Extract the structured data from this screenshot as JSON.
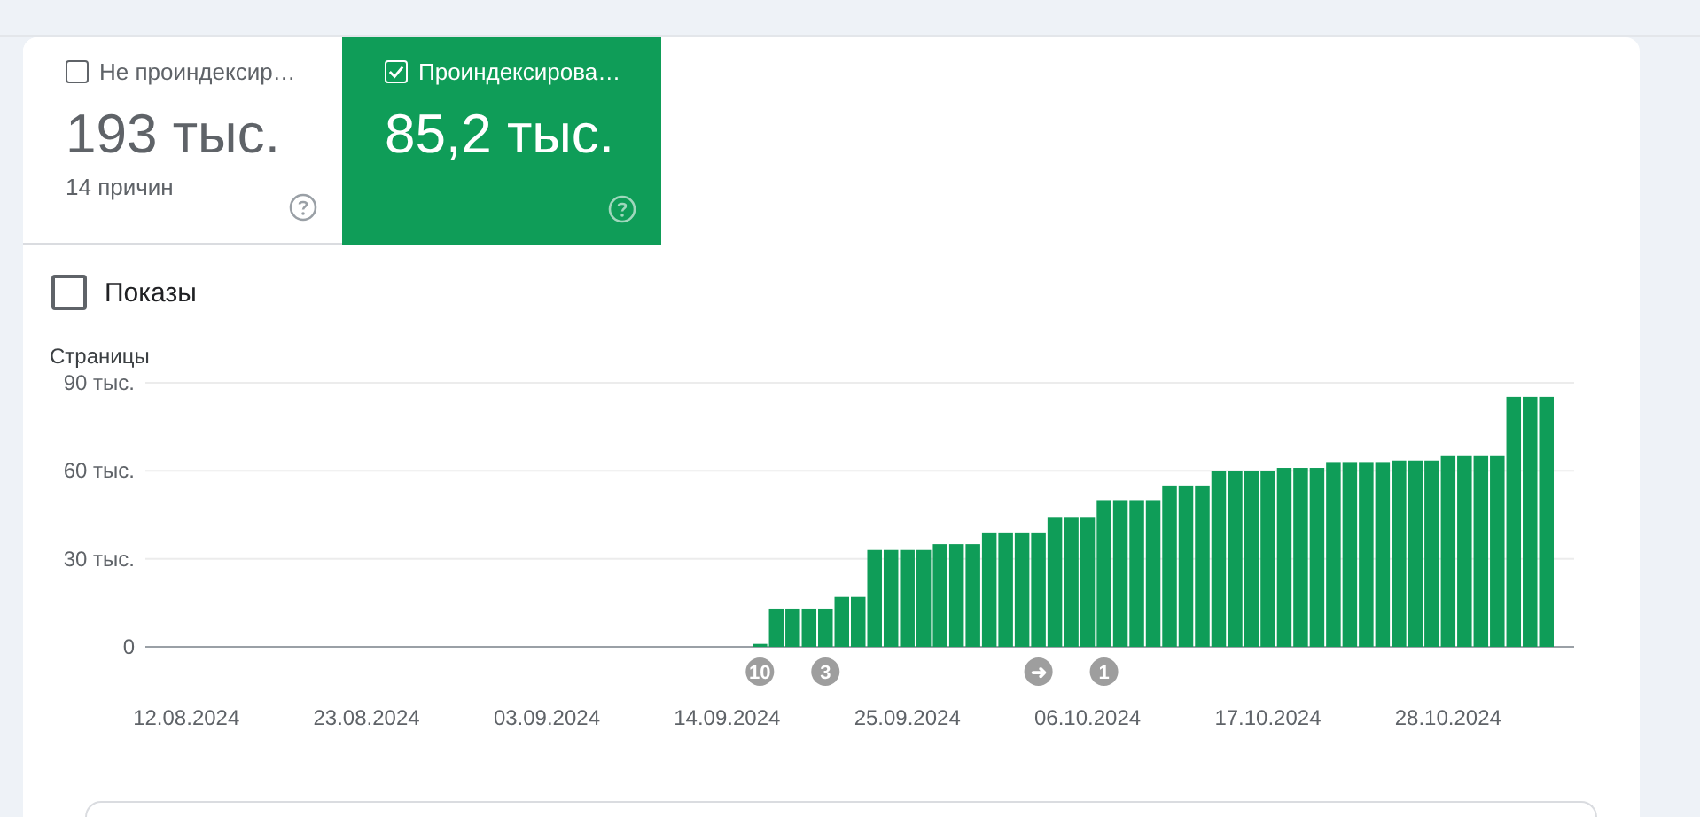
{
  "metric_tabs": [
    {
      "label": "Не проиндексир…",
      "value": "193 тыс.",
      "caption": "14 причин",
      "selected": false,
      "checked": false
    },
    {
      "label": "Проиндексирова…",
      "value": "85,2 тыс.",
      "selected": true,
      "checked": true
    }
  ],
  "impressions_toggle": {
    "label": "Показы",
    "checked": false
  },
  "chart": {
    "chart_data": {
      "type": "bar",
      "ylabel": "Страницы",
      "categories": [
        null,
        null,
        "12.08.2024",
        null,
        null,
        null,
        null,
        null,
        null,
        null,
        null,
        null,
        null,
        "23.08.2024",
        null,
        null,
        null,
        null,
        null,
        null,
        null,
        null,
        null,
        null,
        "03.09.2024",
        null,
        null,
        null,
        null,
        null,
        null,
        null,
        null,
        null,
        null,
        "14.09.2024",
        null,
        null,
        null,
        null,
        null,
        null,
        null,
        null,
        null,
        null,
        "25.09.2024",
        null,
        null,
        null,
        null,
        null,
        null,
        null,
        null,
        null,
        null,
        "06.10.2024",
        null,
        null,
        null,
        null,
        null,
        null,
        null,
        null,
        null,
        null,
        "17.10.2024",
        null,
        null,
        null,
        null,
        null,
        null,
        null,
        null,
        null,
        null,
        "28.10.2024",
        null,
        null,
        null,
        null,
        null,
        null
      ],
      "series": [
        {
          "color": "#0f9d58",
          "values": [
            null,
            null,
            null,
            null,
            null,
            null,
            null,
            null,
            null,
            null,
            null,
            null,
            null,
            null,
            null,
            null,
            null,
            null,
            null,
            null,
            null,
            null,
            null,
            null,
            null,
            null,
            null,
            null,
            null,
            null,
            null,
            null,
            null,
            null,
            null,
            null,
            null,
            1,
            13,
            13,
            13,
            13,
            17,
            17,
            33,
            33,
            33,
            33,
            35,
            35,
            35,
            39,
            39,
            39,
            39,
            44,
            44,
            44,
            50,
            50,
            50,
            50,
            55,
            55,
            55,
            60,
            60,
            60,
            60,
            61,
            61,
            61,
            63,
            63,
            63,
            63,
            63.5,
            63.5,
            63.5,
            65,
            65,
            65,
            65,
            85.2,
            85.2,
            85.2
          ]
        }
      ],
      "ylim": [
        0,
        90
      ],
      "yticks": [
        {
          "value": 0,
          "label": "0"
        },
        {
          "value": 30,
          "label": "30 тыс."
        },
        {
          "value": 60,
          "label": "60 тыс."
        },
        {
          "value": 90,
          "label": "90 тыс."
        }
      ]
    },
    "event_markers": [
      {
        "text": "10"
      },
      {
        "text": "3"
      },
      {
        "text": "➜"
      },
      {
        "text": "1"
      }
    ]
  }
}
